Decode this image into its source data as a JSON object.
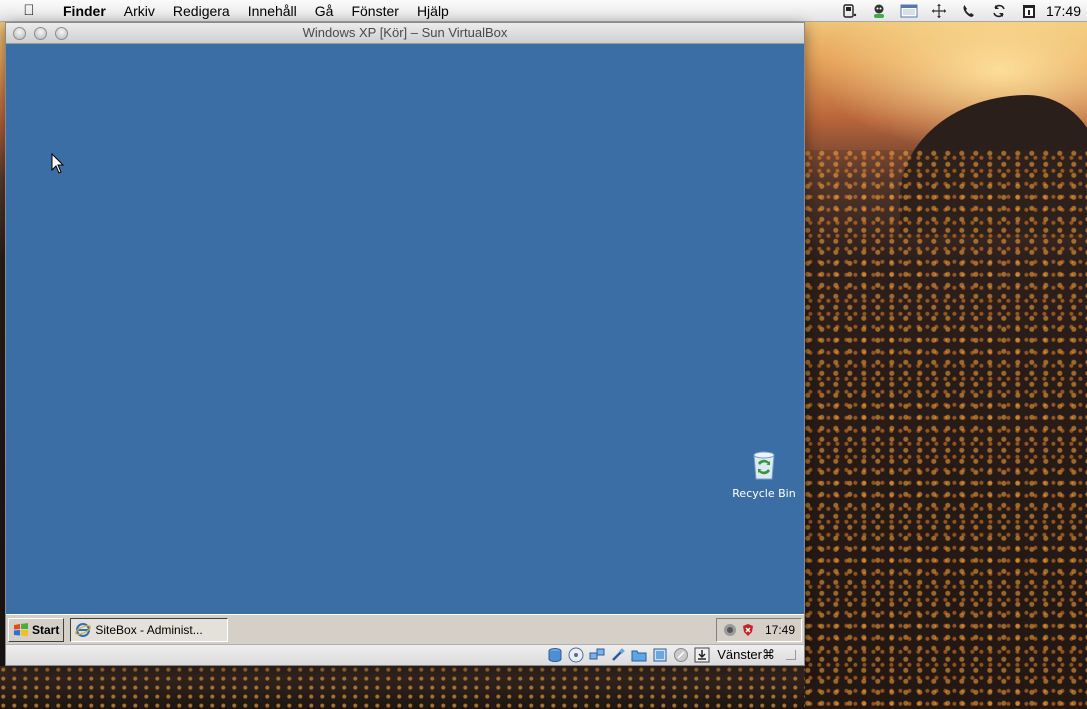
{
  "menubar": {
    "apple_icon": "apple-logo-icon",
    "items": [
      "Finder",
      "Arkiv",
      "Redigera",
      "Innehåll",
      "Gå",
      "Fönster",
      "Hjälp"
    ],
    "tray_icons": [
      "battery-icon",
      "status-person-icon",
      "calendar-icon",
      "spaces-icon",
      "phone-icon",
      "sync-icon",
      "date-icon"
    ],
    "clock": "17:49"
  },
  "window": {
    "title": "Windows XP [Kör] – Sun VirtualBox",
    "background_color": "#3a6ea5"
  },
  "xp_desktop": {
    "recycle_bin_label": "Recycle Bin"
  },
  "taskbar": {
    "start_label": "Start",
    "task_label": "SiteBox - Administ...",
    "clock": "17:49"
  },
  "vb_status": {
    "icons": [
      "hard-disk-icon",
      "cd-icon",
      "network-icon",
      "usb-icon",
      "shared-folder-icon",
      "vrdp-icon",
      "mouse-integration-icon",
      "keyboard-capture-icon"
    ],
    "host_key": "Vänster⌘"
  }
}
